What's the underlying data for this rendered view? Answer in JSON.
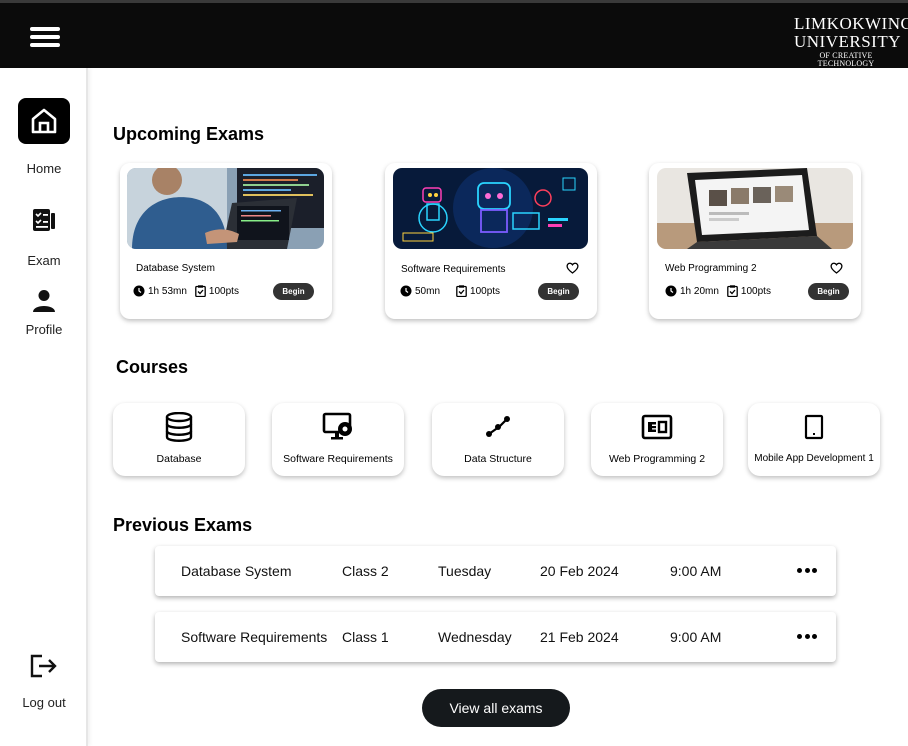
{
  "header": {
    "logo_line1": "LIMKOKWING",
    "logo_line2": "UNIVERSITY",
    "logo_line3": "OF CREATIVE TECHNOLOGY"
  },
  "sidebar": {
    "items": [
      {
        "label": "Home",
        "icon": "home-icon"
      },
      {
        "label": "Exam",
        "icon": "exam-icon"
      },
      {
        "label": "Profile",
        "icon": "user-icon"
      }
    ],
    "logout_label": "Log out"
  },
  "upcoming": {
    "title": "Upcoming Exams",
    "exams": [
      {
        "name": "Database System",
        "duration": "1h 53mn",
        "points": "100pts",
        "button": "Begin"
      },
      {
        "name": "Software Requirements",
        "duration": "50mn",
        "points": "100pts",
        "button": "Begin"
      },
      {
        "name": "Web Programming 2",
        "duration": "1h 20mn",
        "points": "100pts",
        "button": "Begin"
      }
    ]
  },
  "courses": {
    "title": "Courses",
    "items": [
      {
        "name": "Database",
        "icon": "database-icon"
      },
      {
        "name": "Software Requirements",
        "icon": "monitor-settings-icon"
      },
      {
        "name": "Data Structure",
        "icon": "graph-line-icon"
      },
      {
        "name": "Web Programming 2",
        "icon": "web-layout-icon"
      },
      {
        "name": "Mobile App Development 1",
        "icon": "tablet-icon"
      }
    ]
  },
  "previous": {
    "title": "Previous Exams",
    "rows": [
      {
        "name": "Database System",
        "class": "Class 2",
        "day": "Tuesday",
        "date": "20 Feb 2024",
        "time": "9:00 AM"
      },
      {
        "name": "Software Requirements",
        "class": "Class 1",
        "day": "Wednesday",
        "date": "21 Feb 2024",
        "time": "9:00 AM"
      }
    ],
    "view_all": "View all exams"
  }
}
